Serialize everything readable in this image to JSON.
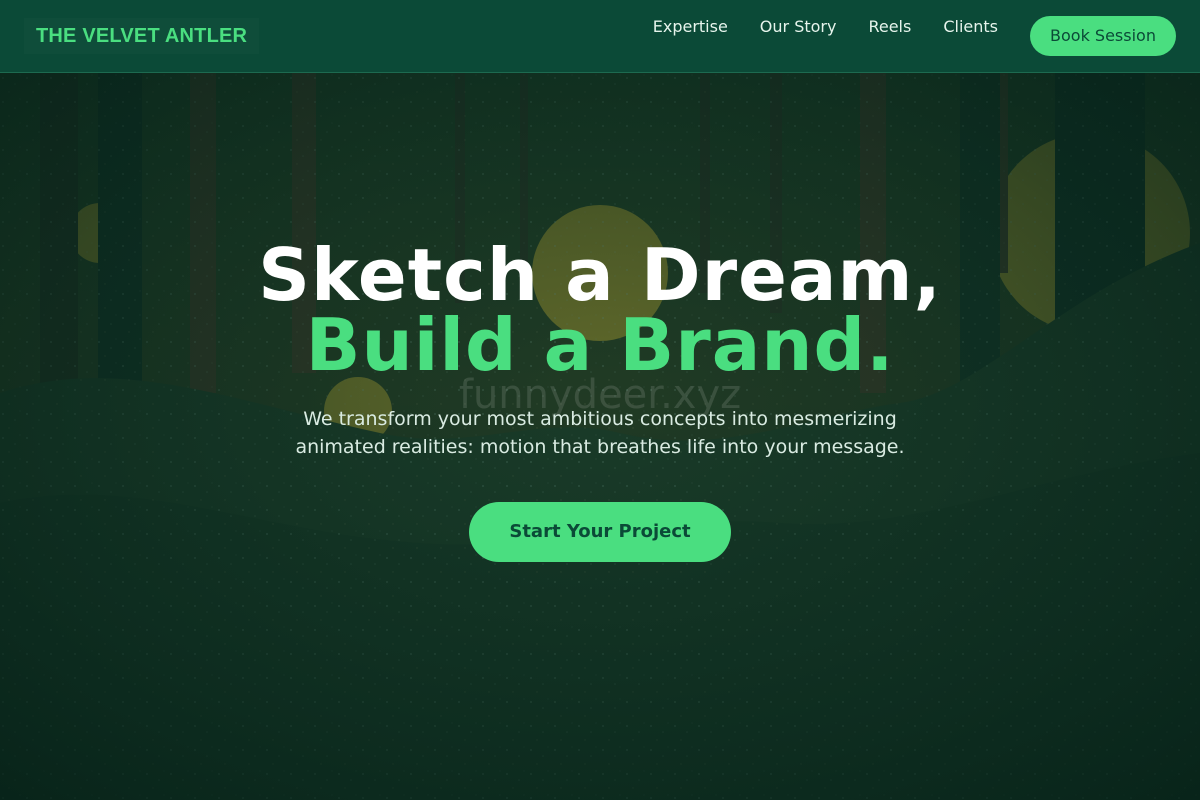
{
  "brand": {
    "name": "THE VELVET ANTLER"
  },
  "nav": {
    "items": [
      {
        "label": "Expertise"
      },
      {
        "label": "Our Story"
      },
      {
        "label": "Reels"
      },
      {
        "label": "Clients"
      }
    ],
    "cta_label": "Book Session"
  },
  "hero": {
    "headline_line1": "Sketch a Dream,",
    "headline_line2": "Build a Brand.",
    "watermark": "funnydeer.xyz",
    "subtitle": "We transform your most ambitious concepts into mesmerizing animated realities: motion that breathes life into your message.",
    "cta_label": "Start Your Project",
    "background_icon": "forest-illustration"
  },
  "colors": {
    "accent": "#4ade80",
    "header_bg": "#0b4a37",
    "hero_overlay": "#0d3b2d",
    "sun": "#c9a227",
    "text_light": "#ffffff"
  }
}
